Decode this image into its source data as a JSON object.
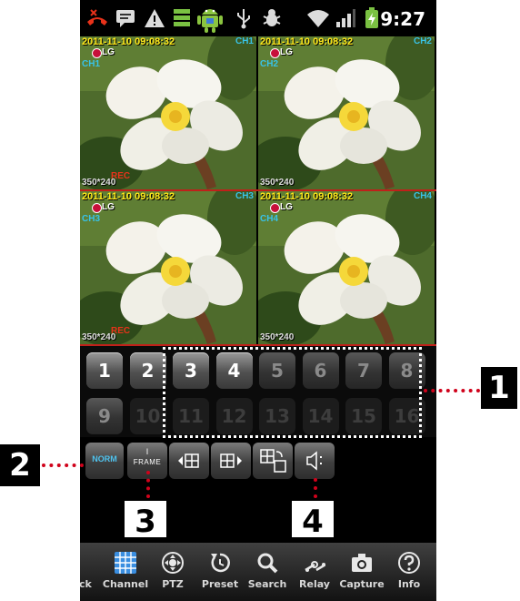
{
  "status_bar": {
    "time": "9:27",
    "icons": [
      "missed-call-icon",
      "message-icon",
      "warning-icon",
      "storage-icon",
      "android-icon",
      "usb-icon",
      "debug-icon",
      "wifi-icon",
      "signal-icon",
      "battery-charging-icon"
    ]
  },
  "video_tiles": [
    {
      "timestamp": "2011-11-10 09:08:32",
      "channel": "CH1",
      "brand": "LG",
      "camera": "CH1",
      "rec": "REC",
      "resolution": "350*240"
    },
    {
      "timestamp": "2011-11-10 09:08:32",
      "channel": "CH2",
      "brand": "LG",
      "camera": "CH2",
      "rec": "",
      "resolution": "350*240"
    },
    {
      "timestamp": "2011-11-10 09:08:32",
      "channel": "CH3",
      "brand": "LG",
      "camera": "CH3",
      "rec": "REC",
      "resolution": "350*240"
    },
    {
      "timestamp": "2011-11-10 09:08:32",
      "channel": "CH4",
      "brand": "LG",
      "camera": "CH4",
      "rec": "",
      "resolution": "350*240"
    }
  ],
  "channels": [
    {
      "label": "1",
      "state": "on"
    },
    {
      "label": "2",
      "state": "on"
    },
    {
      "label": "3",
      "state": "on"
    },
    {
      "label": "4",
      "state": "on"
    },
    {
      "label": "5",
      "state": "off"
    },
    {
      "label": "6",
      "state": "off"
    },
    {
      "label": "7",
      "state": "off"
    },
    {
      "label": "8",
      "state": "off"
    },
    {
      "label": "9",
      "state": "off"
    },
    {
      "label": "10",
      "state": "dim"
    },
    {
      "label": "11",
      "state": "dim"
    },
    {
      "label": "12",
      "state": "dim"
    },
    {
      "label": "13",
      "state": "dim"
    },
    {
      "label": "14",
      "state": "dim"
    },
    {
      "label": "15",
      "state": "dim"
    },
    {
      "label": "16",
      "state": "dim"
    }
  ],
  "tools": {
    "quality_label": "NORM",
    "frame_label": "FRAME",
    "frame_sup": "I"
  },
  "tabs": [
    {
      "label": "Back",
      "icon": "back-icon"
    },
    {
      "label": "Channel",
      "icon": "grid-icon"
    },
    {
      "label": "PTZ",
      "icon": "ptz-icon"
    },
    {
      "label": "Preset",
      "icon": "preset-icon"
    },
    {
      "label": "Search",
      "icon": "search-icon"
    },
    {
      "label": "Relay",
      "icon": "relay-icon"
    },
    {
      "label": "Capture",
      "icon": "camera-icon"
    },
    {
      "label": "Info",
      "icon": "info-icon"
    }
  ],
  "callouts": {
    "c1": "1",
    "c2": "2",
    "c3": "3",
    "c4": "4"
  },
  "colors": {
    "callout_dots": "#d0021b",
    "timestamp": "#ffe81a",
    "channel_text": "#38c3e8",
    "rec": "#e8321a"
  }
}
